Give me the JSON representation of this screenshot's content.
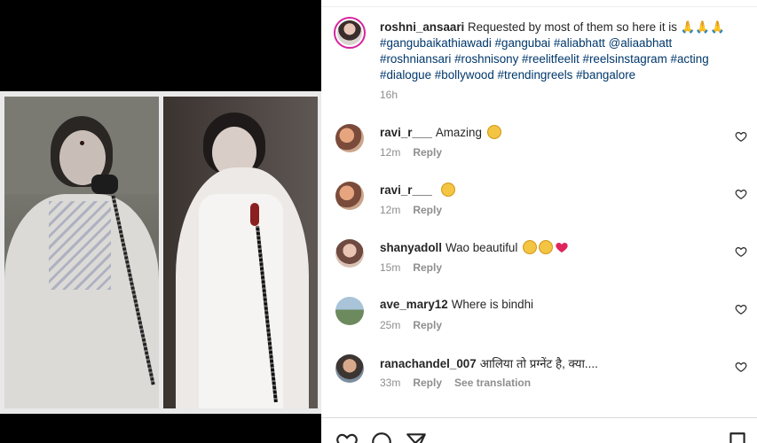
{
  "post": {
    "username": "roshni_ansaari",
    "caption_text": "Requested by most of them so here it is",
    "caption_emoji": "🙏🙏🙏",
    "hashtags_line1": "#gangubaikathiawadi #gangubai #aliabhatt @aliaabhatt",
    "hashtags_line2": "#roshniansari #roshnisony #reelitfeelit #reelsinstagram #acting",
    "hashtags_line3": "#dialogue #bollywood #trendingreels #bangalore",
    "time": "16h"
  },
  "comments": [
    {
      "user": "ravi_r___",
      "text": "Amazing",
      "time": "12m",
      "reply": "Reply",
      "extra": ""
    },
    {
      "user": "ravi_r___",
      "text": "",
      "time": "12m",
      "reply": "Reply",
      "extra": ""
    },
    {
      "user": "shanyadoll",
      "text": "Wao beautiful",
      "time": "15m",
      "reply": "Reply",
      "extra": ""
    },
    {
      "user": "ave_mary12",
      "text": "Where is bindhi",
      "time": "25m",
      "reply": "Reply",
      "extra": ""
    },
    {
      "user": "ranachandel_007",
      "text": "आलिया तो प्रग्नेंट है, क्या....",
      "time": "33m",
      "reply": "Reply",
      "extra": "See translation"
    }
  ],
  "icons": {
    "like": "heart-icon",
    "comment": "comment-icon",
    "share": "share-icon",
    "save": "bookmark-icon"
  },
  "colors": {
    "hashtag": "#00376b",
    "muted": "#8e8e8e",
    "text": "#262626"
  }
}
